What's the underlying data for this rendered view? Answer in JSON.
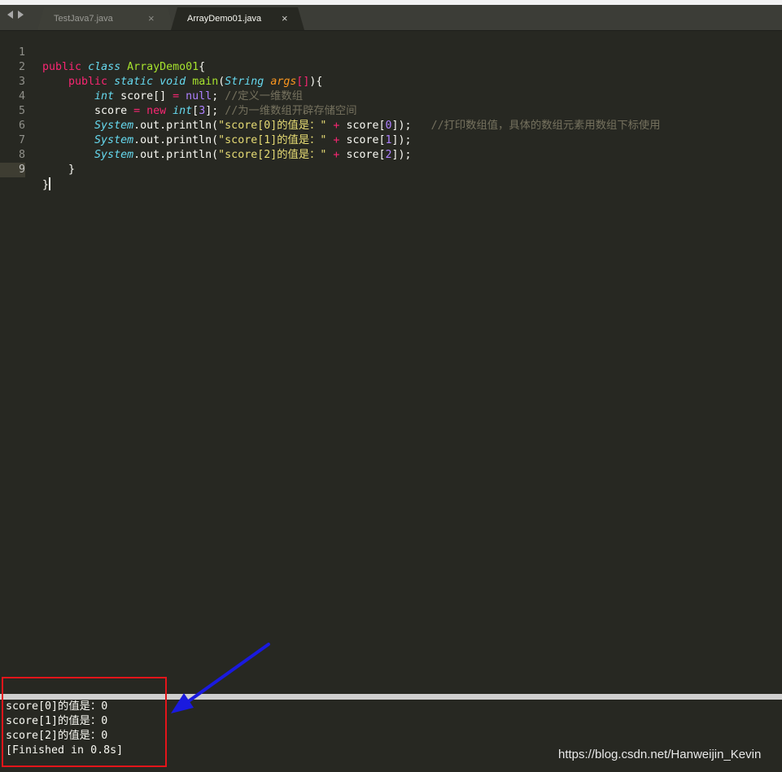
{
  "tabs": [
    {
      "label": "TestJava7.java",
      "close": "×"
    },
    {
      "label": "ArrayDemo01.java",
      "close": "×"
    }
  ],
  "editor": {
    "line_numbers": [
      "1",
      "2",
      "3",
      "4",
      "5",
      "6",
      "7",
      "8",
      "9"
    ],
    "code": {
      "l1": {
        "kw": "public",
        "st": "class",
        "cls": "ArrayDemo01",
        "brace": "{"
      },
      "l2": {
        "kw1": "public",
        "st1": "static",
        "st2": "void",
        "fn": "main",
        "p1": "(",
        "type": "String",
        "param": "args",
        "brackets": "[]",
        "p2": "){"
      },
      "l3": {
        "type": "int",
        "var": " score[] ",
        "eq": "=",
        "nul": " null",
        "semi": "; ",
        "comment": "//定义一维数组"
      },
      "l4": {
        "var": "score ",
        "eq": "=",
        "new": " new ",
        "type": "int",
        "b1": "[",
        "num": "3",
        "b2": "]; ",
        "comment": "//为一维数组开辟存储空间"
      },
      "l5": {
        "cls": "System",
        "mid": ".out.println(",
        "str": "\"score[0]的值是：\"",
        "plus": " + ",
        "var": "score[",
        "num": "0",
        "end": "]);   ",
        "comment": "//打印数组值，具体的数组元素用数组下标使用"
      },
      "l6": {
        "cls": "System",
        "mid": ".out.println(",
        "str": "\"score[1]的值是：\"",
        "plus": " + ",
        "var": "score[",
        "num": "1",
        "end": "]);"
      },
      "l7": {
        "cls": "System",
        "mid": ".out.println(",
        "str": "\"score[2]的值是：\"",
        "plus": " + ",
        "var": "score[",
        "num": "2",
        "end": "]);"
      },
      "l8": {
        "brace": "}"
      },
      "l9": {
        "brace": "}"
      }
    }
  },
  "output": [
    "score[0]的值是：0",
    "score[1]的值是：0",
    "score[2]的值是：0",
    "[Finished in 0.8s]"
  ],
  "watermark": "https://blog.csdn.net/Hanweijin_Kevin",
  "colors": {
    "editor_bg": "#272822",
    "keyword": "#f92672",
    "storage": "#66d9ef",
    "class_name": "#a6e22e",
    "string": "#e6db74",
    "number": "#ae81ff",
    "comment": "#75715e",
    "parameter": "#fd971f",
    "annotation_box": "#e3151a",
    "annotation_arrow": "#1a1adf"
  }
}
